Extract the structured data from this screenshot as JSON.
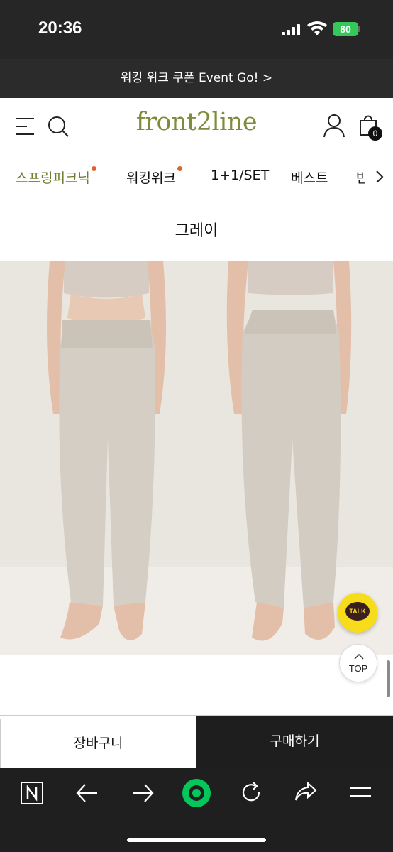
{
  "status_bar": {
    "time": "20:36",
    "battery": "80"
  },
  "promo": {
    "text": "워킹 위크 쿠폰 Event Go! >"
  },
  "header": {
    "logo": "front2line",
    "cart_count": "0"
  },
  "categories": [
    {
      "label": "스프링피크닉",
      "active": true,
      "dot": true
    },
    {
      "label": "워킹위크",
      "active": false,
      "dot": true
    },
    {
      "label": "1+1/SET",
      "active": false,
      "dot": false
    },
    {
      "label": "베스트",
      "active": false,
      "dot": false
    },
    {
      "label": "반",
      "active": false,
      "dot": false
    }
  ],
  "product": {
    "color_name": "그레이"
  },
  "floating": {
    "kakao_label": "TALK",
    "top_label": "TOP"
  },
  "buy_bar": {
    "cart_label": "장바구니",
    "buy_label": "구매하기"
  },
  "colors": {
    "accent": "#6f7d2e",
    "logo": "#7d8c3a",
    "dot": "#e2632a",
    "kakao": "#f7dc1c",
    "naver_green": "#03c75a"
  },
  "browser_toolbar": {
    "icons": [
      "naver-icon",
      "back-icon",
      "forward-icon",
      "green-dot-icon",
      "refresh-icon",
      "share-icon",
      "menu-icon"
    ]
  }
}
